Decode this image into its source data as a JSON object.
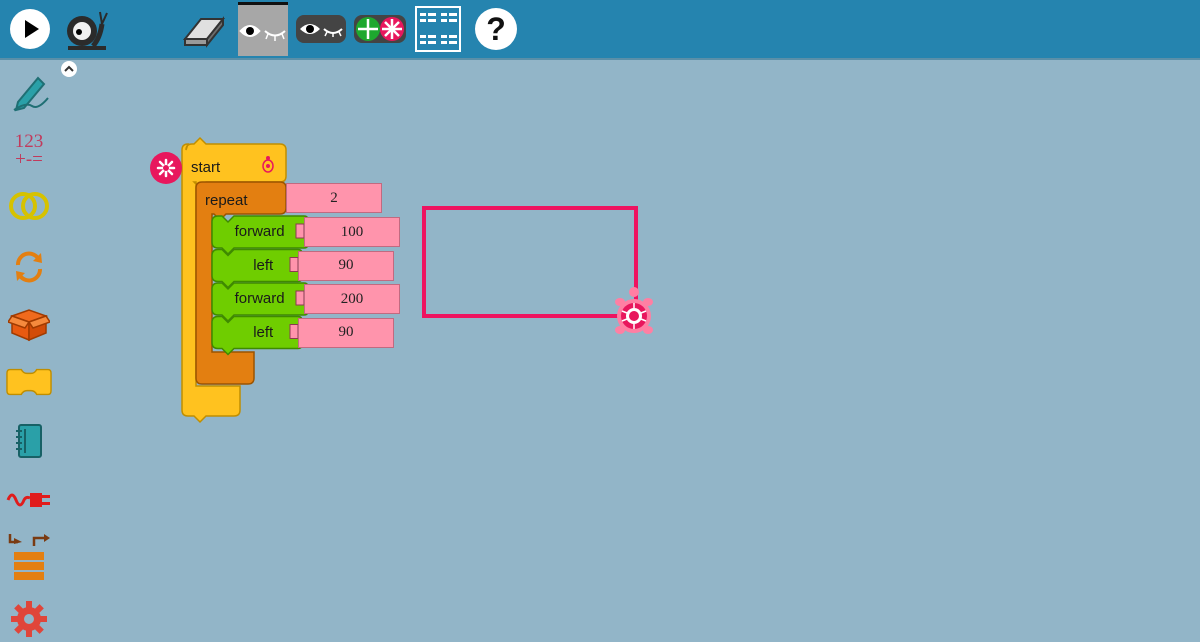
{
  "toolbar": {
    "items": [
      {
        "name": "run-button-icon"
      },
      {
        "name": "slow-run-snail-icon"
      },
      {
        "name": "eraser-icon"
      },
      {
        "name": "hide-blocks-eye-icon"
      },
      {
        "name": "collapse-blocks-icon"
      },
      {
        "name": "expand-collapse-icon"
      },
      {
        "name": "grid-menu-icon"
      },
      {
        "name": "help-icon"
      }
    ],
    "help_label": "?"
  },
  "palette": {
    "items": [
      {
        "name": "pen-palette-icon"
      },
      {
        "name": "number-palette-icon",
        "label_top": "123",
        "label_bottom": "+-="
      },
      {
        "name": "boolean-palette-icon"
      },
      {
        "name": "flow-palette-icon"
      },
      {
        "name": "box-palette-icon"
      },
      {
        "name": "action-palette-icon"
      },
      {
        "name": "notebook-palette-icon"
      },
      {
        "name": "extras-palette-icon"
      },
      {
        "name": "sensors-palette-icon"
      },
      {
        "name": "settings-palette-icon"
      }
    ]
  },
  "program": {
    "start_label": "start",
    "repeat_label": "repeat",
    "repeat_count": "2",
    "commands": [
      {
        "label": "forward",
        "value": "100"
      },
      {
        "label": "left",
        "value": "90"
      },
      {
        "label": "forward",
        "value": "200"
      },
      {
        "label": "left",
        "value": "90"
      }
    ]
  },
  "colors": {
    "topbar": "#2584af",
    "canvas": "#92b5c8",
    "start_block": "#ffc21f",
    "repeat_block": "#e37f11",
    "motion_block": "#6fcd00",
    "arg_block": "#ff94ac",
    "turtle_line": "#ee1360",
    "turtle": "#e8175d"
  },
  "drawing": {
    "pen_color": "#ee1360"
  }
}
